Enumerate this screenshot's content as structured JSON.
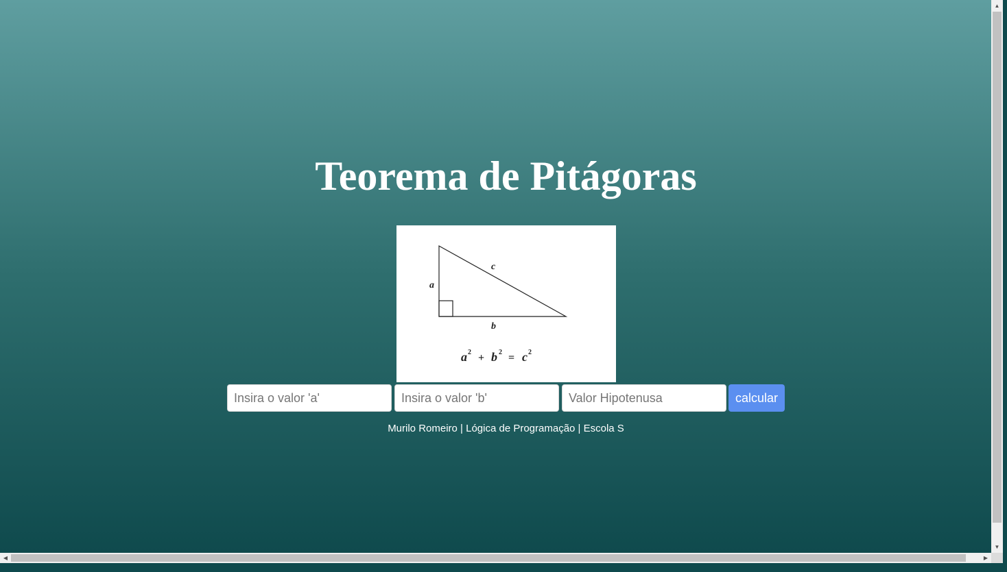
{
  "page": {
    "title": "Teorema de Pitágoras"
  },
  "figure": {
    "label_a": "a",
    "label_b": "b",
    "label_c": "c",
    "formula_a": "a",
    "formula_b": "b",
    "formula_c": "c",
    "formula_exp": "2",
    "formula_plus": "+",
    "formula_eq": "="
  },
  "form": {
    "input_a_placeholder": "Insira o valor 'a'",
    "input_b_placeholder": "Insira o valor 'b'",
    "input_hyp_placeholder": "Valor Hipotenusa",
    "input_a_value": "",
    "input_b_value": "",
    "input_hyp_value": "",
    "button_label": "calcular"
  },
  "footer": {
    "text": "Murilo Romeiro | Lógica de Programação | Escola S"
  },
  "colors": {
    "button_bg": "#5b8ff0",
    "gradient_top": "#5f9ea0",
    "gradient_bottom": "#0f4a4d"
  },
  "icons": {
    "scroll_up": "▲",
    "scroll_down": "▼",
    "scroll_left": "◀",
    "scroll_right": "▶"
  }
}
